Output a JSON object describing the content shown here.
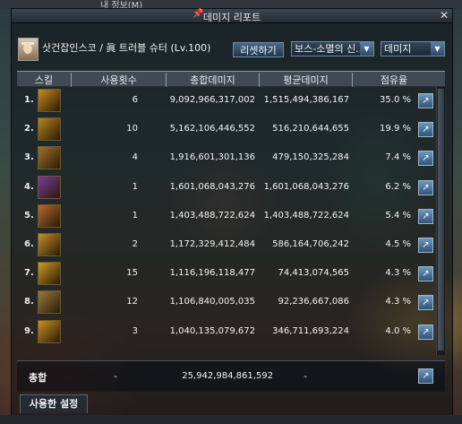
{
  "background_title": "내 정보(M)",
  "window": {
    "title": "데미지 리포트",
    "pin_icon": "pin-icon",
    "close_icon": "close-icon"
  },
  "character": {
    "name": "삿건잡인스코 / 眞 트러블 슈터 (Lv.100)"
  },
  "controls": {
    "reset_label": "리셋하기",
    "target_select": "보스-소멸의 신..",
    "metric_select": "데미지"
  },
  "table": {
    "headers": [
      "스킬",
      "사용횟수",
      "총합데미지",
      "평균데미지",
      "점유율"
    ],
    "rows": [
      {
        "rank": "1.",
        "uses": "6",
        "total": "9,092,966,317,002",
        "average": "1,515,494,386,167",
        "share": "35.0 %",
        "icon_color": "#c88a1c"
      },
      {
        "rank": "2.",
        "uses": "10",
        "total": "5,162,106,446,552",
        "average": "516,210,644,655",
        "share": "19.9 %",
        "icon_color": "#b8861a"
      },
      {
        "rank": "3.",
        "uses": "4",
        "total": "1,916,601,301,136",
        "average": "479,150,325,284",
        "share": "7.4 %",
        "icon_color": "#a0722a"
      },
      {
        "rank": "4.",
        "uses": "1",
        "total": "1,601,068,043,276",
        "average": "1,601,068,043,276",
        "share": "6.2 %",
        "icon_color": "#7a3a9a"
      },
      {
        "rank": "5.",
        "uses": "1",
        "total": "1,403,488,722,624",
        "average": "1,403,488,722,624",
        "share": "5.4 %",
        "icon_color": "#b56a2a"
      },
      {
        "rank": "6.",
        "uses": "2",
        "total": "1,172,329,412,484",
        "average": "586,164,706,242",
        "share": "4.5 %",
        "icon_color": "#c49028"
      },
      {
        "rank": "7.",
        "uses": "15",
        "total": "1,116,196,118,477",
        "average": "74,413,074,565",
        "share": "4.3 %",
        "icon_color": "#d09a20"
      },
      {
        "rank": "8.",
        "uses": "12",
        "total": "1,106,840,005,035",
        "average": "92,236,667,086",
        "share": "4.3 %",
        "icon_color": "#9a7a3a"
      },
      {
        "rank": "9.",
        "uses": "3",
        "total": "1,040,135,079,672",
        "average": "346,711,693,224",
        "share": "4.0 %",
        "icon_color": "#c8901e"
      }
    ]
  },
  "total": {
    "label": "총합",
    "uses": "-",
    "sum": "25,942,984,861,592",
    "average": "-"
  },
  "bottom_tab": {
    "label": "사용한 설정"
  }
}
